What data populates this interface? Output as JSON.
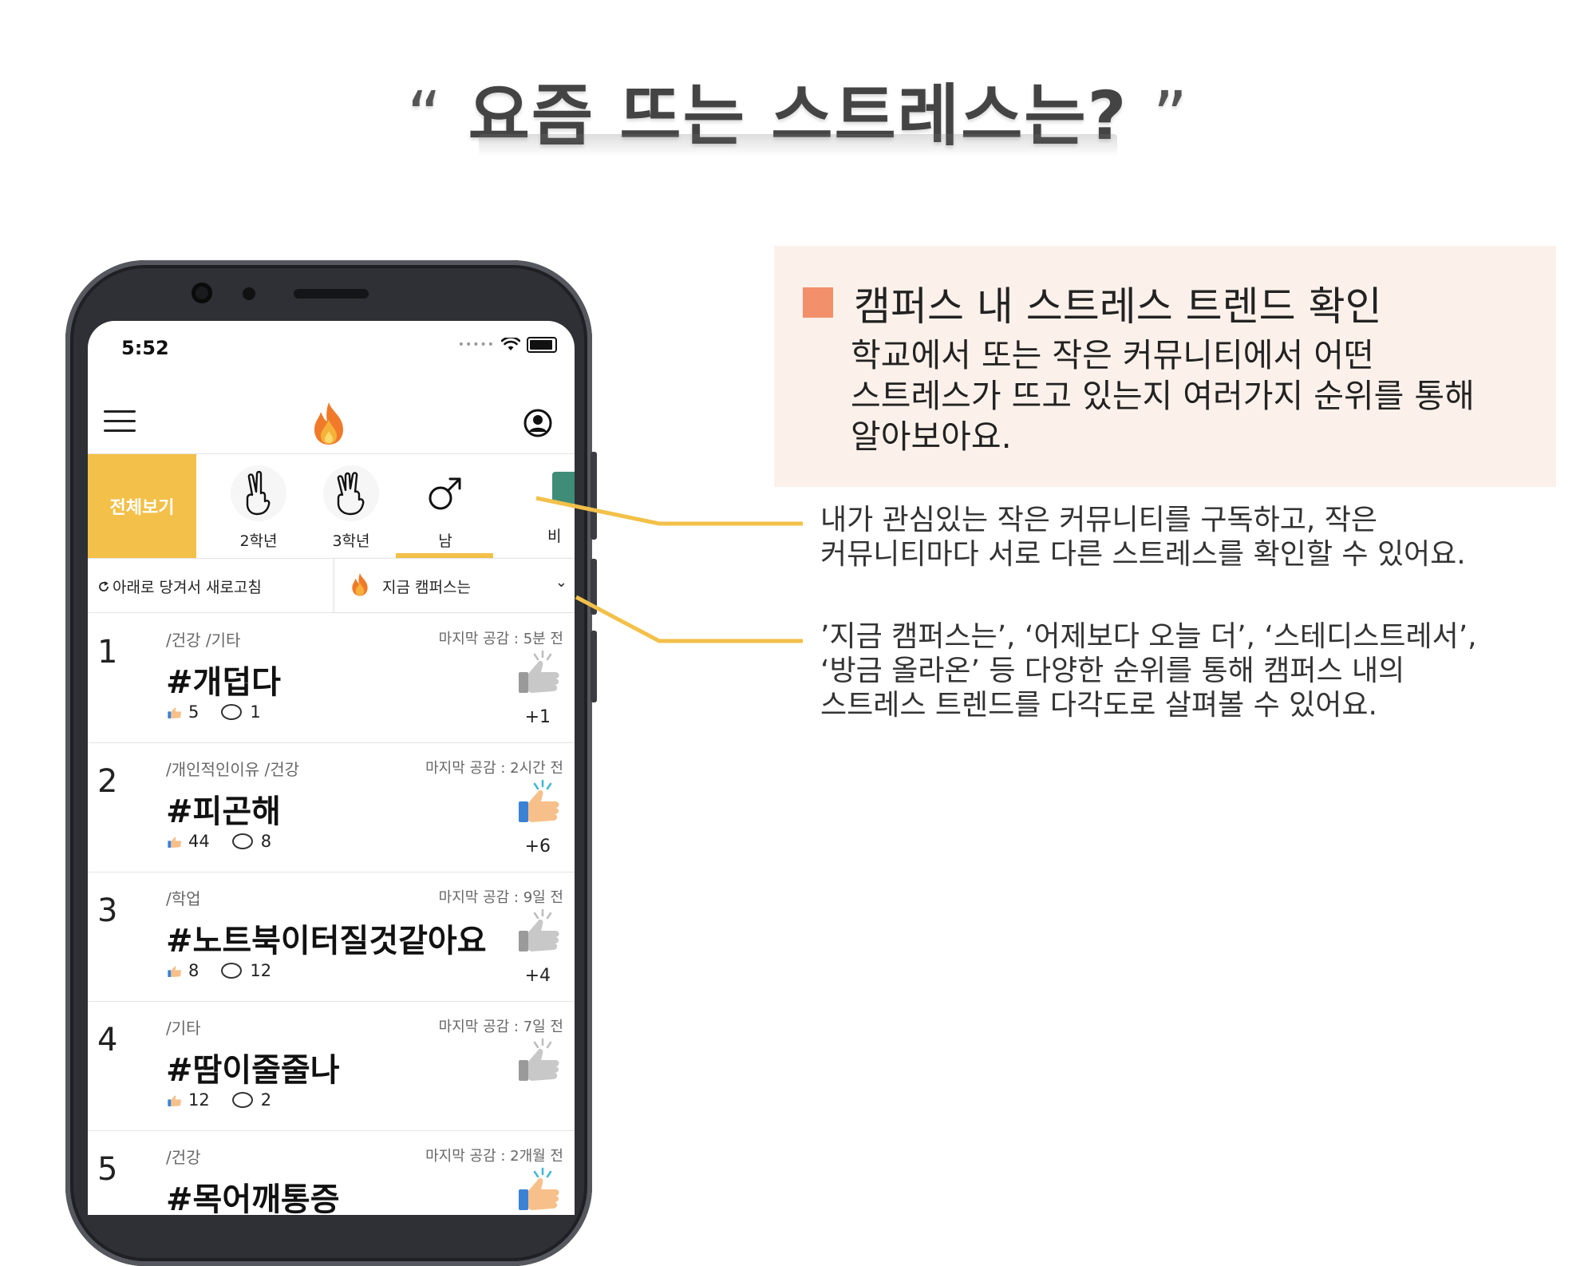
{
  "headline": {
    "open_quote": "“",
    "text": "요즘 뜨는 스트레스는?",
    "close_quote": "”"
  },
  "info": {
    "title": "캠퍼스 내 스트레스 트렌드 확인",
    "lines": [
      "학교에서 또는 작은 커뮤니티에서 어떤",
      "스트레스가 뜨고 있는지 여러가지 순위를 통해",
      "알아보아요."
    ],
    "accent": "#f1906a",
    "background": "#fcf1ea"
  },
  "notes": [
    {
      "lines": [
        "내가 관심있는 작은 커뮤니티를 구독하고, 작은",
        "커뮤니티마다 서로 다른 스트레스를 확인할 수 있어요."
      ]
    },
    {
      "lines": [
        "’지금 캠퍼스는’, ‘어제보다 오늘 더’, ‘스테디스트레서’,",
        "‘방금 올라온’ 등 다양한 순위를 통해 캠퍼스 내의",
        "스트레스 트렌드를 다각도로 살펴볼 수 있어요."
      ]
    }
  ],
  "phone": {
    "status_time": "5:52",
    "categories": [
      {
        "label": "전체보기",
        "selected_bg": "#f3c049"
      },
      {
        "label": "2학년",
        "icon": "two-fingers-hand-icon"
      },
      {
        "label": "3학년",
        "icon": "three-fingers-hand-icon"
      },
      {
        "label": "남",
        "icon": "male-symbol-icon"
      },
      {
        "label": "비"
      }
    ],
    "refresh_label": "아래로 당겨서 새로고침",
    "sort_label": "지금 캠퍼스는",
    "ranks": [
      {
        "num": "1",
        "category": "/건강 /기타",
        "last": "마지막 공감 : 5분 전",
        "title": "#개덥다",
        "likes": "5",
        "comments": "1",
        "delta": "+1",
        "active": false
      },
      {
        "num": "2",
        "category": "/개인적인이유 /건강",
        "last": "마지막 공감 : 2시간 전",
        "title": "#피곤해",
        "likes": "44",
        "comments": "8",
        "delta": "+6",
        "active": true
      },
      {
        "num": "3",
        "category": "/학업",
        "last": "마지막 공감 : 9일 전",
        "title": "#노트북이터질것같아요",
        "likes": "8",
        "comments": "12",
        "delta": "+4",
        "active": false
      },
      {
        "num": "4",
        "category": "/기타",
        "last": "마지막 공감 : 7일 전",
        "title": "#땀이줄줄나",
        "likes": "12",
        "comments": "2",
        "delta": "",
        "active": false
      },
      {
        "num": "5",
        "category": "/건강",
        "last": "마지막 공감 : 2개월 전",
        "title": "#목어깨통증",
        "likes": "",
        "comments": "",
        "delta": "",
        "active": true
      }
    ],
    "accent": "#f3c049"
  },
  "connector_color": "#f3c049"
}
